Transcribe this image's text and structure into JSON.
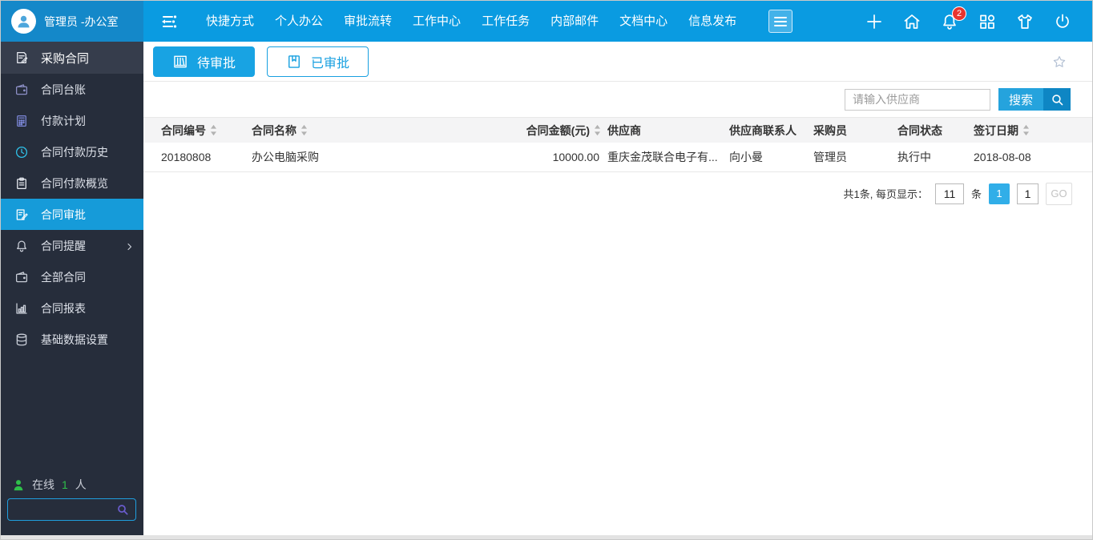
{
  "topbar": {
    "user_name": "管理员 -办公室",
    "nav_items": [
      "快捷方式",
      "个人办公",
      "审批流转",
      "工作中心",
      "工作任务",
      "内部邮件",
      "文档中心",
      "信息发布"
    ],
    "notification_badge": "2",
    "right_icons": [
      "plus-icon",
      "home-icon",
      "bell-icon",
      "apps-icon",
      "shirt-icon",
      "power-icon"
    ]
  },
  "sidebar": {
    "items": [
      {
        "label": "采购合同",
        "icon": "contract-document-icon",
        "icon_color": "#e9ecf2",
        "section": true,
        "active": false,
        "has_children": false
      },
      {
        "label": "合同台账",
        "icon": "wallet-icon",
        "icon_color": "#8d90c7",
        "section": false,
        "active": false,
        "has_children": false
      },
      {
        "label": "付款计划",
        "icon": "calculator-icon",
        "icon_color": "#7b86d6",
        "section": false,
        "active": false,
        "has_children": false
      },
      {
        "label": "合同付款历史",
        "icon": "clock-icon",
        "icon_color": "#2fc2ea",
        "section": false,
        "active": false,
        "has_children": false
      },
      {
        "label": "合同付款概览",
        "icon": "clipboard-icon",
        "icon_color": "#e9ecf2",
        "section": false,
        "active": false,
        "has_children": false
      },
      {
        "label": "合同审批",
        "icon": "document-approve-icon",
        "icon_color": "#ffffff",
        "section": false,
        "active": true,
        "has_children": false
      },
      {
        "label": "合同提醒",
        "icon": "bell-icon",
        "icon_color": "#c9ced8",
        "section": false,
        "active": false,
        "has_children": true
      },
      {
        "label": "全部合同",
        "icon": "wallet-icon",
        "icon_color": "#c9ced8",
        "section": false,
        "active": false,
        "has_children": false
      },
      {
        "label": "合同报表",
        "icon": "chart-icon",
        "icon_color": "#c9ced8",
        "section": false,
        "active": false,
        "has_children": false
      },
      {
        "label": "基础数据设置",
        "icon": "database-icon",
        "icon_color": "#c9ced8",
        "section": false,
        "active": false,
        "has_children": false
      }
    ],
    "online_label": "在线",
    "online_count": "1",
    "online_unit": "人"
  },
  "tabs": [
    {
      "label": "待审批",
      "icon": "bookshelf-icon",
      "active": true
    },
    {
      "label": "已审批",
      "icon": "book-icon",
      "active": false
    }
  ],
  "filter": {
    "placeholder": "请输入供应商",
    "search_label": "搜索"
  },
  "table": {
    "columns": [
      {
        "label": "合同编号",
        "sortable": true,
        "align": "left"
      },
      {
        "label": "合同名称",
        "sortable": true,
        "align": "left"
      },
      {
        "label": "合同金额(元)",
        "sortable": true,
        "align": "right"
      },
      {
        "label": "供应商",
        "sortable": false,
        "align": "left"
      },
      {
        "label": "供应商联系人",
        "sortable": false,
        "align": "left"
      },
      {
        "label": "采购员",
        "sortable": false,
        "align": "left"
      },
      {
        "label": "合同状态",
        "sortable": false,
        "align": "left"
      },
      {
        "label": "签订日期",
        "sortable": true,
        "align": "left"
      }
    ],
    "rows": [
      [
        "20180808",
        "办公电脑采购",
        "10000.00",
        "重庆金茂联合电子有...",
        "向小曼",
        "管理员",
        "执行中",
        "2018-08-08"
      ]
    ]
  },
  "pagination": {
    "summary": "共1条, 每页显示：",
    "page_size": "11",
    "unit": "条",
    "current_page": "1",
    "goto_value": "1",
    "go_label": "GO"
  },
  "colors": {
    "header_blue": "#0a9be1",
    "user_area_blue": "#1488c9",
    "active_blue": "#169bd9",
    "sidebar_bg": "#262d3b",
    "badge_red": "#e8342e",
    "online_green": "#2fbf4a"
  }
}
